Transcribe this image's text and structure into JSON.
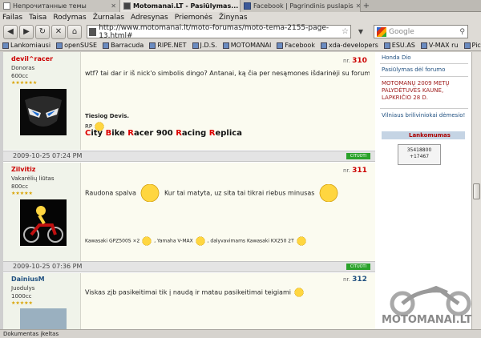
{
  "tabs": [
    {
      "label": "Непрочитанные темы",
      "active": false
    },
    {
      "label": "Motomanai.LT - Pasiūlymas...",
      "active": true
    },
    {
      "label": "Facebook | Pagrindinis puslapis",
      "active": false
    }
  ],
  "menu": [
    "Failas",
    "Taisa",
    "Rodymas",
    "Žurnalas",
    "Adresynas",
    "Priemonės",
    "Žinynas"
  ],
  "address": {
    "url": "http://www.motomanai.lt/moto-forumas/moto-tema-2155-page-13.html#"
  },
  "search": {
    "placeholder": "Google"
  },
  "bookmarks": [
    "Lankomiausi",
    "openSUSE",
    "Barracuda",
    "RIPE.NET",
    "J.D.S.",
    "MOTOMANAI",
    "Facebook",
    "xda-developers",
    "ESU.AS",
    "V-MAX ru",
    "Picasa"
  ],
  "posts": [
    {
      "username": "devil^racer",
      "location": "Donoras",
      "bike": "600cc",
      "stars": "★★★★★★",
      "num_label": "nr.",
      "num": "310",
      "text": "wtf? tai dar ir iš nick'o simbolis dingo? Antanai, ką čia per nesąmones išdarinėji su forumu...",
      "sig_title": "Tiesiog Devis.",
      "sig_rp": "RP",
      "sig_bike": [
        "C",
        "ity ",
        "B",
        "ike ",
        "R",
        "acer 900 ",
        "R",
        "acing ",
        "R",
        "eplica"
      ]
    },
    {
      "date": "2009-10-25 07:24 PM",
      "cite": "CITUOTI",
      "username": "Zilvitiz",
      "location": "Vakarėlių liūtas",
      "bike": "800cc",
      "stars": "★★★★★",
      "num_label": "nr.",
      "num": "311",
      "text1": "Raudona spalva",
      "text2": "Kur tai matyta, uz sita tai tikrai riebus minusas",
      "sig_a": "Kawasaki GPZ500S ×2",
      "sig_b": ", Yamaha V-MAX",
      "sig_c": ", dalyvavimams Kawasaki KX250 2T"
    },
    {
      "date": "2009-10-25 07:36 PM",
      "cite": "CITUOTI",
      "username": "DainiusM",
      "location": "Juodulys",
      "bike": "1000cc",
      "stars": "★★★★★",
      "num_label": "nr.",
      "num": "312",
      "text": "Viskas zjb pasikeitimai tik į naudą ir matau pasikeitimai teigiami"
    }
  ],
  "sidebar": {
    "link1": "Honda Dio",
    "link2": "Pasiūlymas dėl forumo",
    "event": "MOTOMANŲ 2009 METŲ PALYDĖTUVĖS KAUNE, LAPKRIČIO 28 D.",
    "link3": "Vilniaus briliviniokai dėmesio!",
    "lank_title": "Lankomumas",
    "counter1": "35418800",
    "counter2": "+17467",
    "logo": "MOTOMANAI.LT"
  },
  "status": "Dokumentas įkeltas"
}
